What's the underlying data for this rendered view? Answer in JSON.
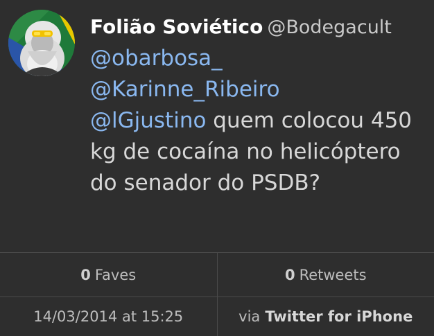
{
  "tweet": {
    "display_name": "Folião Soviético",
    "handle": "@Bodegacult",
    "mentions": [
      "@obarbosa_",
      "@Karinne_Ribeiro",
      "@lGjustino"
    ],
    "text": "quem colocou 450 kg de cocaína no helicóptero do senador do PSDB?"
  },
  "stats": {
    "faves_count": "0",
    "faves_label": "Faves",
    "retweets_count": "0",
    "retweets_label": "Retweets"
  },
  "meta": {
    "timestamp": "14/03/2014 at 15:25",
    "via_label": "via",
    "client": "Twitter for iPhone"
  },
  "colors": {
    "background": "#2e2e2e",
    "mention": "#8ab8f0",
    "divider": "#4a4a4a"
  },
  "icons": {
    "avatar": "profile-portrait"
  }
}
